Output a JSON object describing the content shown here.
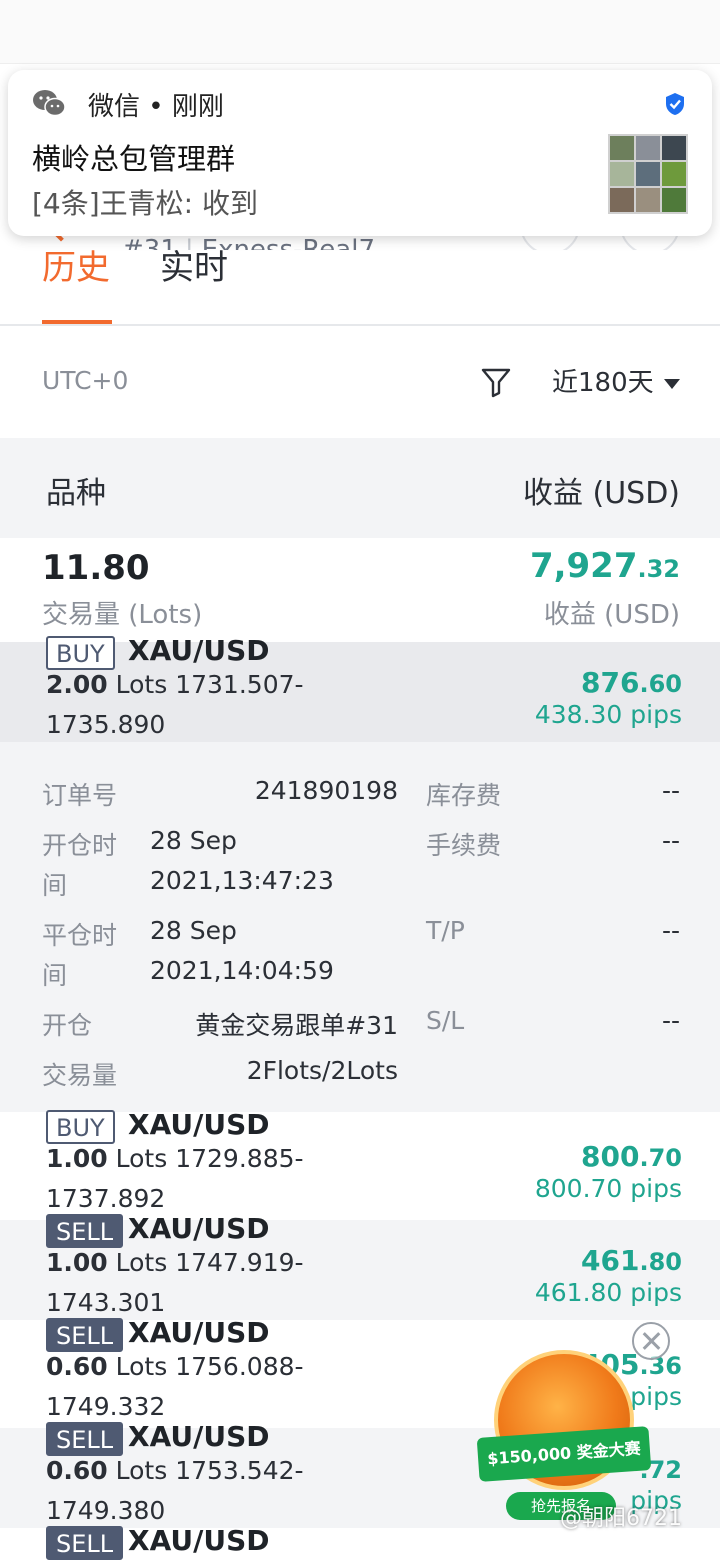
{
  "notification": {
    "app": "微信 • 刚刚",
    "title": "横岭总包管理群",
    "body": "[4条]王青松: 收到"
  },
  "header": {
    "account_num": "#31",
    "account_sep": "|",
    "server": "Exness-Real7"
  },
  "tabs": [
    {
      "label": "历史",
      "active": true
    },
    {
      "label": "实时",
      "active": false
    }
  ],
  "filter": {
    "timezone": "UTC+0",
    "range": "近180天"
  },
  "table_header": {
    "left": "品种",
    "right": "收益 (USD)"
  },
  "summary": {
    "volume": "11.80",
    "volume_label": "交易量 (Lots)",
    "profit_main": "7,927",
    "profit_dec": ".32",
    "profit_label": "收益 (USD)"
  },
  "trades": [
    {
      "side": "BUY",
      "symbol": "XAU/USD",
      "lots": "2.00",
      "lots_unit": "Lots",
      "price_a": "1731.507-",
      "price_b": "1735.890",
      "profit_main": "876",
      "profit_dec": ".60",
      "pips": "438.30 pips"
    },
    {
      "side": "BUY",
      "symbol": "XAU/USD",
      "lots": "1.00",
      "lots_unit": "Lots",
      "price_a": "1729.885-",
      "price_b": "1737.892",
      "profit_main": "800",
      "profit_dec": ".70",
      "pips": "800.70 pips"
    },
    {
      "side": "SELL",
      "symbol": "XAU/USD",
      "lots": "1.00",
      "lots_unit": "Lots",
      "price_a": "1747.919-",
      "price_b": "1743.301",
      "profit_main": "461",
      "profit_dec": ".80",
      "pips": "461.80 pips"
    },
    {
      "side": "SELL",
      "symbol": "XAU/USD",
      "lots": "0.60",
      "lots_unit": "Lots",
      "price_a": "1756.088-",
      "price_b": "1749.332",
      "profit_main": "405",
      "profit_dec": ".36",
      "pips": "pips"
    },
    {
      "side": "SELL",
      "symbol": "XAU/USD",
      "lots": "0.60",
      "lots_unit": "Lots",
      "price_a": "1753.542-",
      "price_b": "1749.380",
      "profit_main": "",
      "profit_dec": ".72",
      "pips": "pips"
    },
    {
      "side": "SELL",
      "symbol": "XAU/USD"
    }
  ],
  "detail": {
    "order_label": "订单号",
    "order_value": "241890198",
    "open_time_label_1": "开仓时",
    "open_time_label_2": "间",
    "open_time_1": "28 Sep",
    "open_time_2": "2021,13:47:23",
    "close_time_label_1": "平仓时",
    "close_time_label_2": "间",
    "close_time_1": "28 Sep",
    "close_time_2": "2021,14:04:59",
    "open_label": "开仓",
    "open_value": "黄金交易跟单#31",
    "volume_label": "交易量",
    "volume_value": "2Flots/2Lots",
    "swap_label": "库存费",
    "swap_value": "--",
    "fee_label": "手续费",
    "fee_value": "--",
    "tp_label": "T/P",
    "tp_value": "--",
    "sl_label": "S/L",
    "sl_value": "--"
  },
  "promo": {
    "prize": "$150,000 奖金大赛",
    "cta": "抢先报名"
  },
  "watermark": "@朝阳6721",
  "colors": {
    "accent": "#f26a2e",
    "profit": "#1fa58f",
    "side_tag": "#4f5a72",
    "row_alt": "#f3f4f6"
  }
}
